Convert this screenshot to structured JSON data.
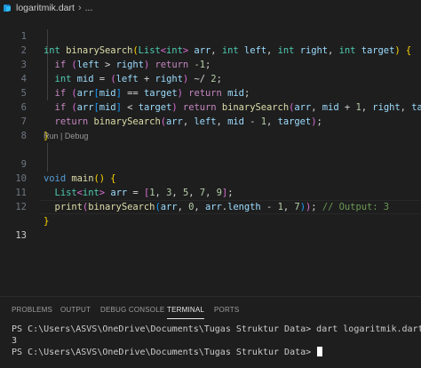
{
  "breadcrumb": {
    "file": "logaritmik.dart",
    "separator": "›",
    "more": "..."
  },
  "editor": {
    "line_numbers": [
      "1",
      "2",
      "3",
      "4",
      "5",
      "6",
      "7",
      "8",
      "9",
      "10",
      "11",
      "12",
      "13"
    ],
    "codelens": "Run | Debug",
    "code": {
      "l1": {
        "t1": "int",
        "t2": "binarySearch",
        "t3": "(",
        "t4": "List",
        "t5": "<",
        "t6": "int",
        "t7": ">",
        "t8": "arr",
        "t9": ",",
        "t10": "int",
        "t11": "left",
        "t12": ",",
        "t13": "int",
        "t14": "right",
        "t15": ",",
        "t16": "int",
        "t17": "target",
        "t18": ")",
        "t19": "{"
      },
      "l2": {
        "t1": "if",
        "t2": "(",
        "t3": "left",
        "t4": ">",
        "t5": "right",
        "t6": ")",
        "t7": "return",
        "t8": "-1",
        "t9": ";"
      },
      "l3": {
        "t1": "int",
        "t2": "mid",
        "t3": "=",
        "t4": "(",
        "t5": "left",
        "t6": "+",
        "t7": "right",
        "t8": ")",
        "t9": "~/",
        "t10": "2",
        "t11": ";"
      },
      "l4": {
        "t1": "if",
        "t2": "(",
        "t3": "arr",
        "t4": "[",
        "t5": "mid",
        "t6": "]",
        "t7": "==",
        "t8": "target",
        "t9": ")",
        "t10": "return",
        "t11": "mid",
        "t12": ";"
      },
      "l5": {
        "t1": "if",
        "t2": "(",
        "t3": "arr",
        "t4": "[",
        "t5": "mid",
        "t6": "]",
        "t7": "<",
        "t8": "target",
        "t9": ")",
        "t10": "return",
        "t11": "binarySearch",
        "t12": "(",
        "t13": "arr",
        "t14": ",",
        "t15": "mid",
        "t16": "+",
        "t17": "1",
        "t18": ",",
        "t19": "right",
        "t20": ",",
        "t21": "target",
        "t22": ");"
      },
      "l6": {
        "t1": "return",
        "t2": "binarySearch",
        "t3": "(",
        "t4": "arr",
        "t5": ",",
        "t6": "left",
        "t7": ",",
        "t8": "mid",
        "t9": "-",
        "t10": "1",
        "t11": ",",
        "t12": "target",
        "t13": ")",
        "t14": ";"
      },
      "l7": {
        "t1": "}"
      },
      "l9": {
        "t1": "void",
        "t2": "main",
        "t3": "()",
        "t4": "{"
      },
      "l10": {
        "t1": "List",
        "t2": "<",
        "t3": "int",
        "t4": ">",
        "t5": "arr",
        "t6": "=",
        "t7": "[",
        "t8": "1",
        "t9": ",",
        "t10": "3",
        "t11": ",",
        "t12": "5",
        "t13": ",",
        "t14": "7",
        "t15": ",",
        "t16": "9",
        "t17": "]",
        "t18": ";"
      },
      "l11": {
        "t1": "print",
        "t2": "(",
        "t3": "binarySearch",
        "t4": "(",
        "t5": "arr",
        "t6": ",",
        "t7": "0",
        "t8": ",",
        "t9": "arr",
        "t10": ".",
        "t11": "length",
        "t12": "-",
        "t13": "1",
        "t14": ",",
        "t15": "7",
        "t16": ")",
        "t17": ")",
        "t18": ";",
        "t19": "// Output: 3"
      },
      "l12": {
        "t1": "}"
      }
    }
  },
  "panel": {
    "tabs": [
      "PROBLEMS",
      "OUTPUT",
      "DEBUG CONSOLE",
      "TERMINAL",
      "PORTS"
    ],
    "active_tab": "TERMINAL"
  },
  "terminal": {
    "line1_prompt": "PS C:\\Users\\ASVS\\OneDrive\\Documents\\Tugas Struktur Data>",
    "line1_cmd": " dart logaritmik.dart",
    "line2": "3",
    "line3_prompt": "PS C:\\Users\\ASVS\\OneDrive\\Documents\\Tugas Struktur Data>"
  },
  "colors": {
    "background": "#1e1e1e",
    "keyword": "#569cd6",
    "type": "#4ec9b0",
    "function": "#dcdcaa",
    "variable": "#9cdcfe",
    "number": "#b5cea8",
    "control": "#c586c0",
    "comment": "#6a9955",
    "bracket_level1": "#ffd700",
    "bracket_level2": "#da70d6",
    "bracket_level3": "#179fff"
  },
  "icons": {
    "file": "dart-file-icon"
  }
}
